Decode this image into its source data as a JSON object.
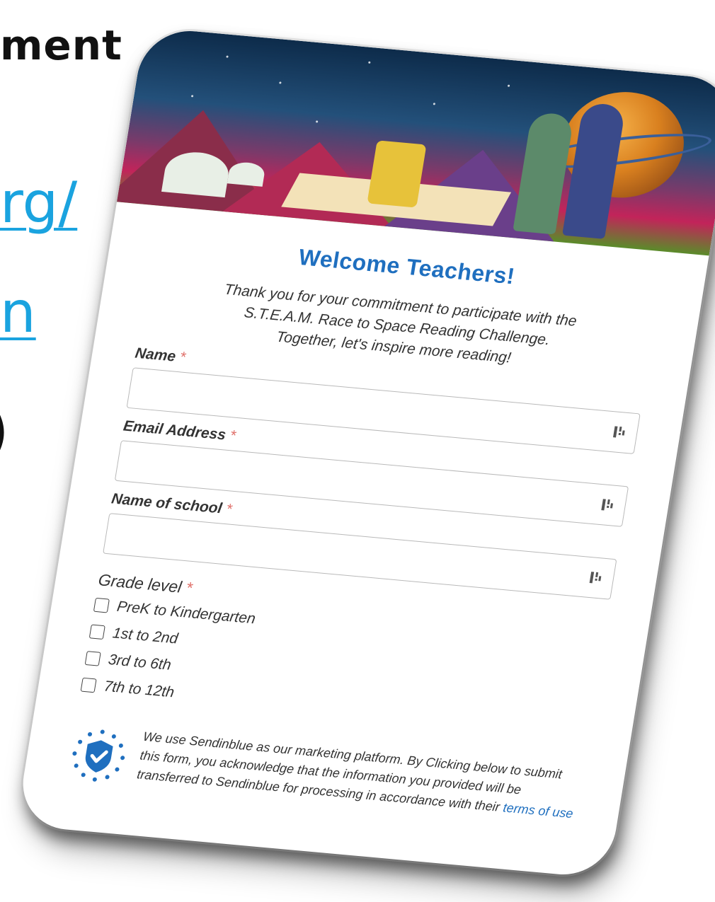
{
  "slide": {
    "title_fragment": "ment",
    "link_line1": "rg/",
    "link_line2": "n",
    "bracket": ")"
  },
  "form": {
    "banner_icon": "space-reading-illustration",
    "welcome_title": "Welcome Teachers!",
    "intro_line1": "Thank you for your commitment to participate with the",
    "intro_line2": "S.T.E.A.M. Race to Space Reading Challenge.",
    "intro_line3": "Together, let's inspire more reading!",
    "required_marker": "*",
    "fields": [
      {
        "label": "Name",
        "value": "",
        "icon": "password-manager-icon"
      },
      {
        "label": "Email Address",
        "value": "",
        "icon": "password-manager-icon"
      },
      {
        "label": "Name of school",
        "value": "",
        "icon": "password-manager-icon"
      }
    ],
    "grade_label": "Grade level",
    "grade_options": [
      {
        "label": "PreK to Kindergarten",
        "checked": false
      },
      {
        "label": "1st to 2nd",
        "checked": false
      },
      {
        "label": "3rd to 6th",
        "checked": false
      },
      {
        "label": "7th to 12th",
        "checked": false
      }
    ],
    "consent_text": "We use Sendinblue as our marketing platform. By Clicking below to submit this form, you acknowledge that the information you provided will be transferred to Sendinblue for processing in accordance with their",
    "terms_link": "terms of use",
    "consent_icon": "gdpr-shield-check-icon"
  },
  "colors": {
    "accent": "#1f6fbf",
    "link": "#1aa3df",
    "required": "#e0706a"
  }
}
